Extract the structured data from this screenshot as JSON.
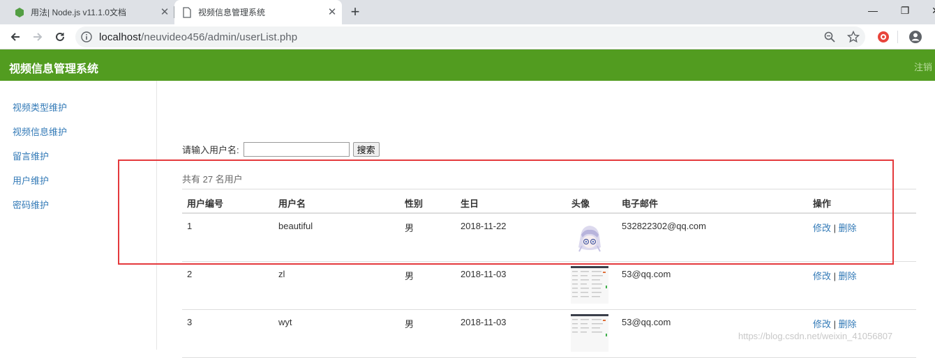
{
  "browser": {
    "tabs": [
      {
        "title": "用法| Node.js v11.1.0文档",
        "active": false
      },
      {
        "title": "视频信息管理系统",
        "active": true
      }
    ],
    "url_host": "localhost",
    "url_path": "/neuvideo456/admin/userList.php"
  },
  "header": {
    "title": "视频信息管理系统",
    "logout": "注销"
  },
  "sidebar": {
    "items": [
      "视频类型维护",
      "视频信息维护",
      "留言维护",
      "用户维护",
      "密码维护"
    ]
  },
  "search": {
    "label": "请输入用户名:",
    "value": "",
    "button": "搜索"
  },
  "summary": "共有 27 名用户",
  "table": {
    "columns": [
      "用户编号",
      "用户名",
      "性别",
      "生日",
      "头像",
      "电子邮件",
      "操作"
    ],
    "rows": [
      {
        "id": "1",
        "username": "beautiful",
        "gender": "男",
        "birthday": "2018-11-22",
        "avatar": "anime-avatar",
        "email": "532822302@qq.com"
      },
      {
        "id": "2",
        "username": "zl",
        "gender": "男",
        "birthday": "2018-11-03",
        "avatar": "screenshot-avatar",
        "email": "53@qq.com"
      },
      {
        "id": "3",
        "username": "wyt",
        "gender": "男",
        "birthday": "2018-11-03",
        "avatar": "screenshot-avatar",
        "email": "53@qq.com"
      }
    ],
    "edit_label": "修改",
    "separator": "|",
    "delete_label": "删除"
  },
  "watermark": "https://blog.csdn.net/weixin_41056807",
  "colors": {
    "header_bg": "#529c20",
    "link": "#337ab7",
    "highlight_box": "#e4393c"
  }
}
